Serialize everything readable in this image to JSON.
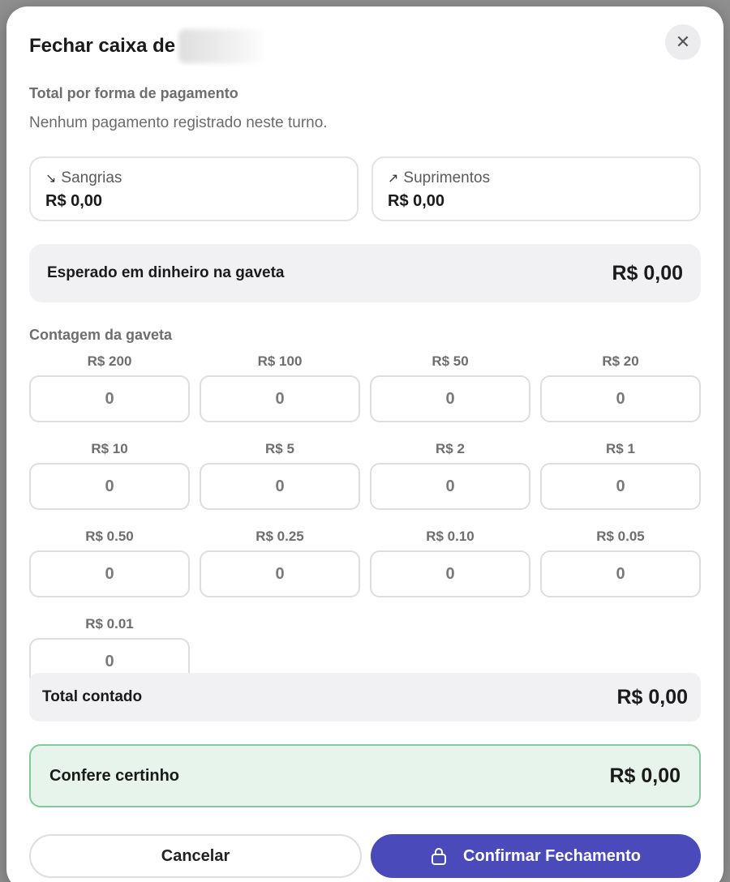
{
  "modal": {
    "title": "Fechar caixa de",
    "close_glyph": "✕"
  },
  "payments": {
    "heading": "Total por forma de pagamento",
    "empty_text": "Nenhum pagamento registrado neste turno."
  },
  "cards": {
    "sangrias": {
      "icon": "trending-down-icon",
      "glyph": "↘",
      "label": "Sangrias",
      "value": "R$ 0,00"
    },
    "suprimentos": {
      "icon": "trending-up-icon",
      "glyph": "↗",
      "label": "Suprimentos",
      "value": "R$ 0,00"
    }
  },
  "expected": {
    "label": "Esperado em dinheiro na gaveta",
    "value": "R$ 0,00"
  },
  "counting": {
    "heading": "Contagem da gaveta",
    "denominations": [
      {
        "label": "R$ 200",
        "value": "0"
      },
      {
        "label": "R$ 100",
        "value": "0"
      },
      {
        "label": "R$ 50",
        "value": "0"
      },
      {
        "label": "R$ 20",
        "value": "0"
      },
      {
        "label": "R$ 10",
        "value": "0"
      },
      {
        "label": "R$ 5",
        "value": "0"
      },
      {
        "label": "R$ 2",
        "value": "0"
      },
      {
        "label": "R$ 1",
        "value": "0"
      },
      {
        "label": "R$ 0.50",
        "value": "0"
      },
      {
        "label": "R$ 0.25",
        "value": "0"
      },
      {
        "label": "R$ 0.10",
        "value": "0"
      },
      {
        "label": "R$ 0.05",
        "value": "0"
      },
      {
        "label": "R$ 0.01",
        "value": "0"
      }
    ]
  },
  "total": {
    "label": "Total contado",
    "value": "R$ 0,00"
  },
  "match": {
    "label": "Confere certinho",
    "value": "R$ 0,00",
    "accent": "#86c79c"
  },
  "actions": {
    "cancel_label": "Cancelar",
    "confirm_label": "Confirmar Fechamento",
    "confirm_icon": "lock-icon",
    "confirm_color": "#4b4aba"
  }
}
